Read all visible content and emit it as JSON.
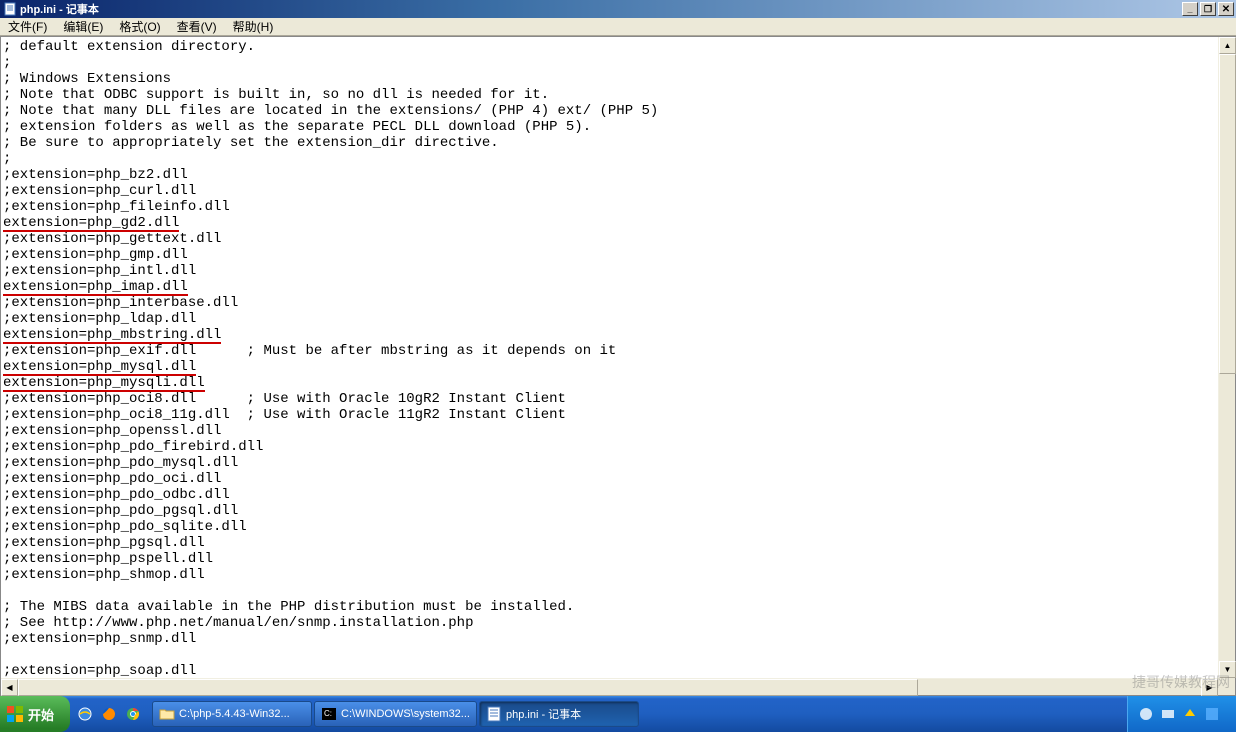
{
  "window": {
    "title": "php.ini - 记事本",
    "minimize": "_",
    "restore": "❐",
    "close": "✕"
  },
  "menu": {
    "file": "文件(F)",
    "edit": "编辑(E)",
    "format": "格式(O)",
    "view": "查看(V)",
    "help": "帮助(H)"
  },
  "lines": [
    {
      "t": "; default extension directory."
    },
    {
      "t": ";"
    },
    {
      "t": "; Windows Extensions"
    },
    {
      "t": "; Note that ODBC support is built in, so no dll is needed for it."
    },
    {
      "t": "; Note that many DLL files are located in the extensions/ (PHP 4) ext/ (PHP 5)"
    },
    {
      "t": "; extension folders as well as the separate PECL DLL download (PHP 5)."
    },
    {
      "t": "; Be sure to appropriately set the extension_dir directive."
    },
    {
      "t": ";"
    },
    {
      "t": ";extension=php_bz2.dll"
    },
    {
      "t": ";extension=php_curl.dll"
    },
    {
      "t": ";extension=php_fileinfo.dll"
    },
    {
      "t": "extension=php_gd2.dll",
      "u": true
    },
    {
      "t": ";extension=php_gettext.dll"
    },
    {
      "t": ";extension=php_gmp.dll"
    },
    {
      "t": ";extension=php_intl.dll"
    },
    {
      "t": "extension=php_imap.dll",
      "u": true
    },
    {
      "t": ";extension=php_interbase.dll"
    },
    {
      "t": ";extension=php_ldap.dll"
    },
    {
      "t": "extension=php_mbstring.dll",
      "u": true
    },
    {
      "t": ";extension=php_exif.dll      ; Must be after mbstring as it depends on it"
    },
    {
      "t": "extension=php_mysql.dll",
      "u": true
    },
    {
      "t": "extension=php_mysqli.dll",
      "u": true
    },
    {
      "t": ";extension=php_oci8.dll      ; Use with Oracle 10gR2 Instant Client"
    },
    {
      "t": ";extension=php_oci8_11g.dll  ; Use with Oracle 11gR2 Instant Client"
    },
    {
      "t": ";extension=php_openssl.dll"
    },
    {
      "t": ";extension=php_pdo_firebird.dll"
    },
    {
      "t": ";extension=php_pdo_mysql.dll"
    },
    {
      "t": ";extension=php_pdo_oci.dll"
    },
    {
      "t": ";extension=php_pdo_odbc.dll"
    },
    {
      "t": ";extension=php_pdo_pgsql.dll"
    },
    {
      "t": ";extension=php_pdo_sqlite.dll"
    },
    {
      "t": ";extension=php_pgsql.dll"
    },
    {
      "t": ";extension=php_pspell.dll"
    },
    {
      "t": ";extension=php_shmop.dll"
    },
    {
      "t": ""
    },
    {
      "t": "; The MIBS data available in the PHP distribution must be installed. "
    },
    {
      "t": "; See http://www.php.net/manual/en/snmp.installation.php "
    },
    {
      "t": ";extension=php_snmp.dll"
    },
    {
      "t": ""
    },
    {
      "t": ";extension=php_soap.dll"
    }
  ],
  "taskbar": {
    "start": "开始",
    "tasks": [
      {
        "label": "C:\\php-5.4.43-Win32...",
        "icon": "folder"
      },
      {
        "label": "C:\\WINDOWS\\system32...",
        "icon": "cmd"
      },
      {
        "label": "php.ini - 记事本",
        "icon": "notepad",
        "active": true
      }
    ],
    "tray_time": ""
  },
  "watermark": "捷哥传媒教程网"
}
